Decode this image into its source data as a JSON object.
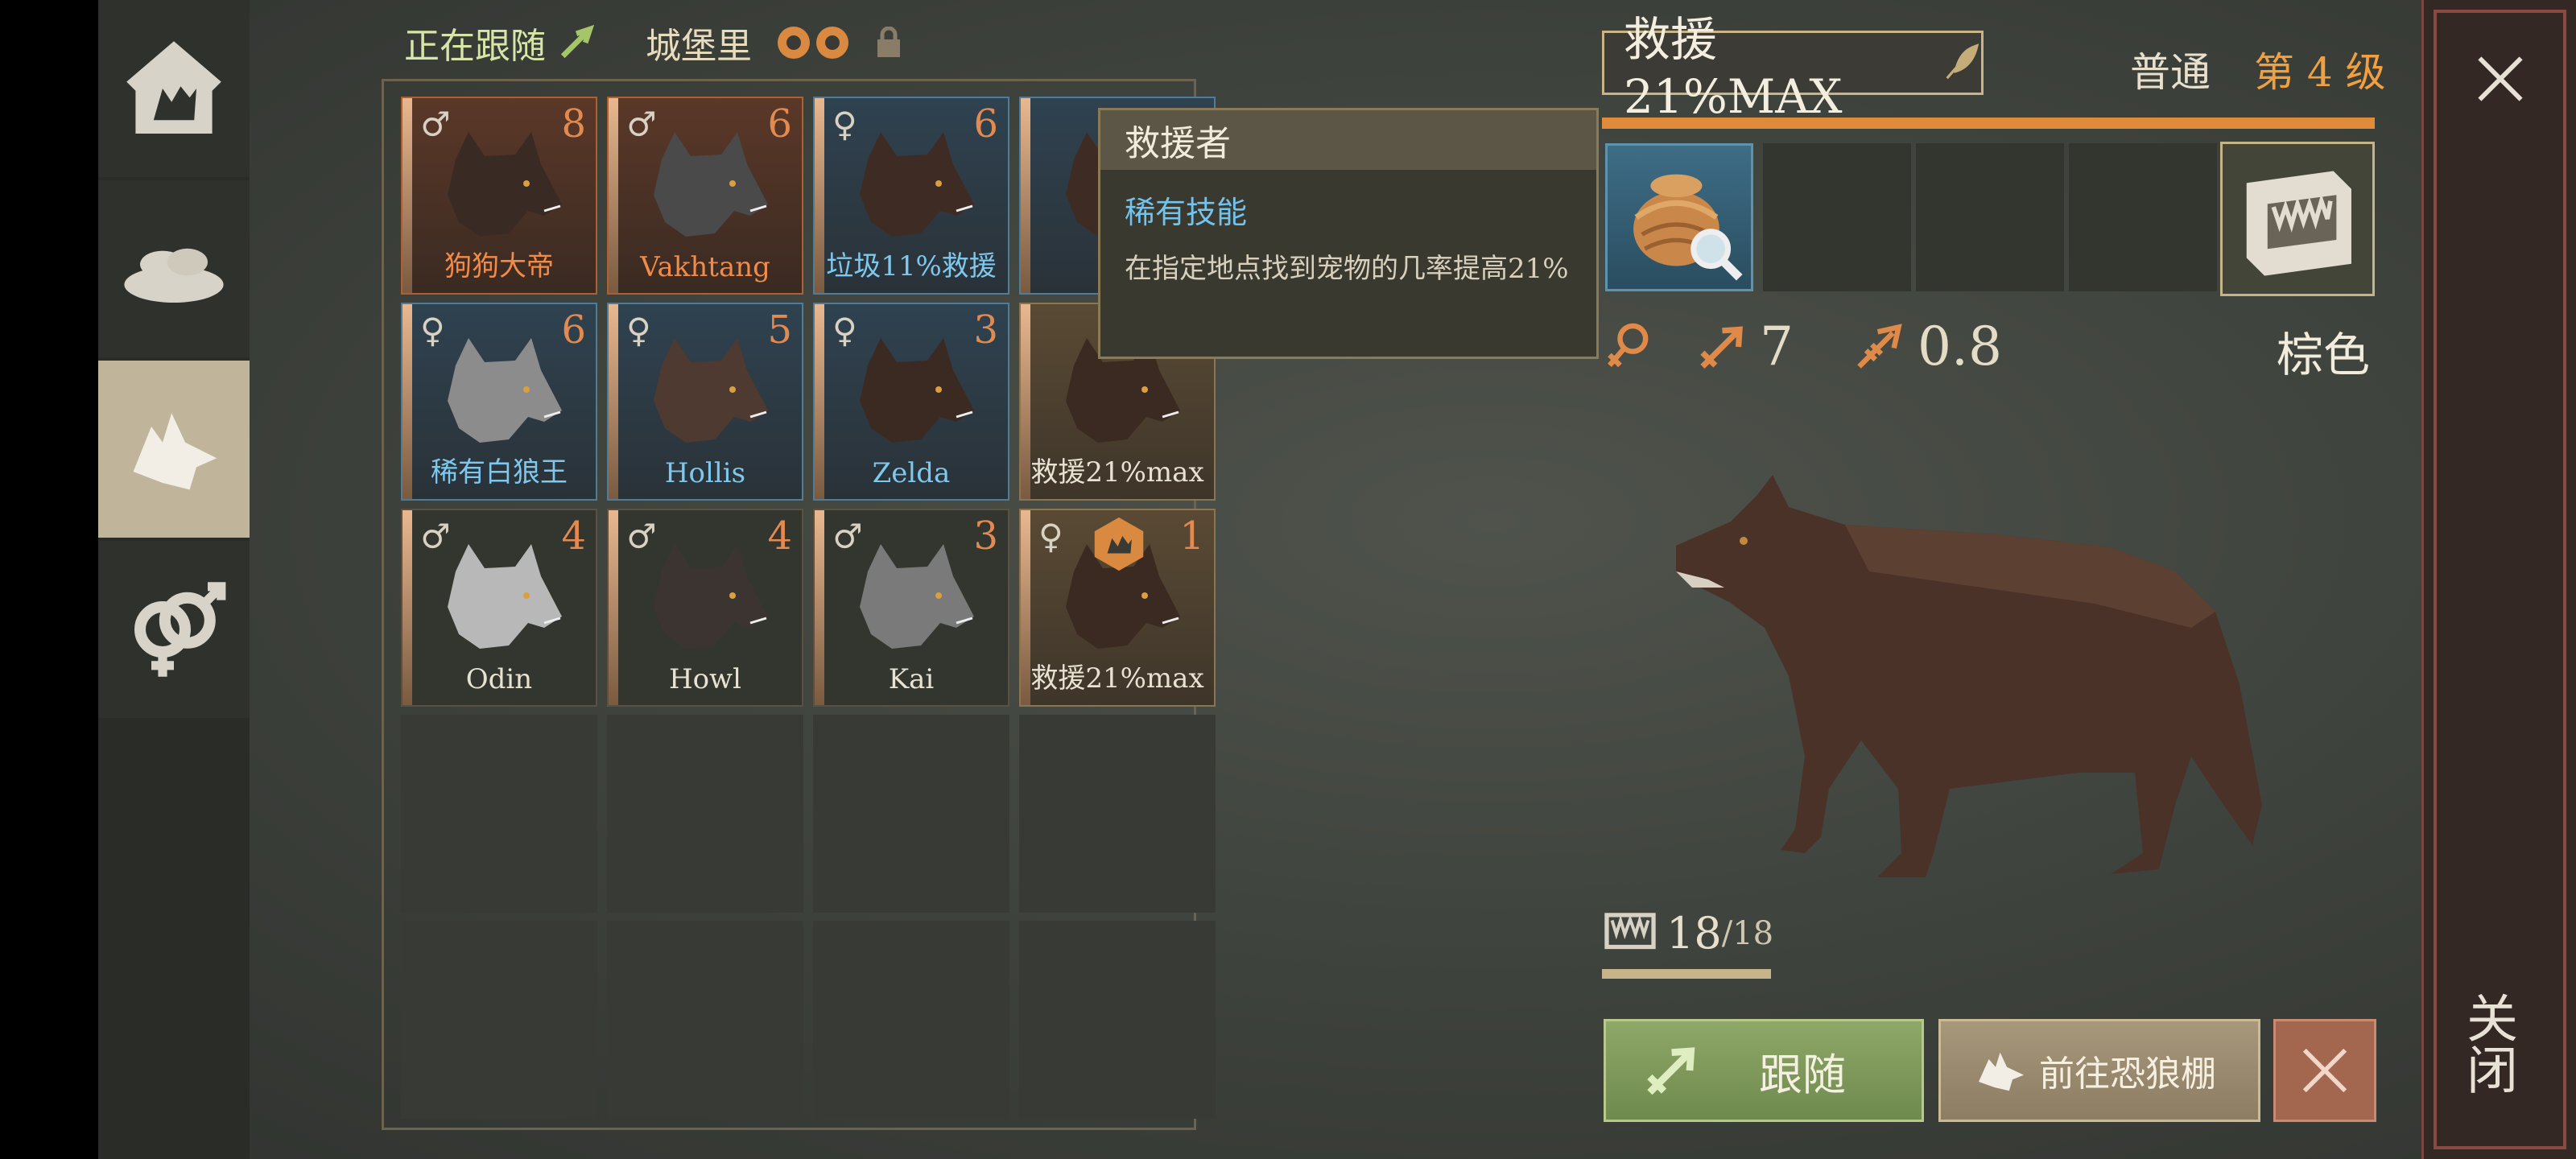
{
  "header": {
    "following_label": "正在跟随",
    "castle_label": "城堡里"
  },
  "pets": [
    {
      "gender": "♂",
      "level": "8",
      "name": "狗狗大帝",
      "rarity": "epic",
      "fur": "#3a2a24"
    },
    {
      "gender": "♂",
      "level": "6",
      "name": "Vakhtang",
      "rarity": "epic",
      "fur": "#4a4a4a"
    },
    {
      "gender": "♀",
      "level": "6",
      "name": "垃圾11%救援",
      "rarity": "rare",
      "fur": "#3e2c24"
    },
    {
      "gender": "",
      "level": "",
      "name": "",
      "rarity": "rare",
      "fur": "#3e2c24"
    },
    {
      "gender": "♀",
      "level": "6",
      "name": "稀有白狼王",
      "rarity": "rare",
      "fur": "#8c8c8c"
    },
    {
      "gender": "♀",
      "level": "5",
      "name": "Hollis",
      "rarity": "rare",
      "fur": "#4e3a30"
    },
    {
      "gender": "♀",
      "level": "3",
      "name": "Zelda",
      "rarity": "rare",
      "fur": "#3a2a22"
    },
    {
      "gender": "",
      "level": "",
      "name": "救援21%max",
      "rarity": "gold",
      "fur": "#3a2a22"
    },
    {
      "gender": "♂",
      "level": "4",
      "name": "Odin",
      "rarity": "norm",
      "fur": "#b8b8b8"
    },
    {
      "gender": "♂",
      "level": "4",
      "name": "Howl",
      "rarity": "norm",
      "fur": "#3c3430"
    },
    {
      "gender": "♂",
      "level": "3",
      "name": "Kai",
      "rarity": "norm",
      "fur": "#7a7a7a"
    },
    {
      "gender": "♀",
      "level": "1",
      "name": "救援21%max",
      "rarity": "gold",
      "fur": "#3a2a22"
    }
  ],
  "tooltip": {
    "title": "救援者",
    "type": "稀有技能",
    "description": "在指定地点找到宠物的几率提高21%"
  },
  "detail": {
    "name": "救援21%MAX",
    "rarity": "普通",
    "level": "第 4 级",
    "attack": "7",
    "speed": "0.8",
    "color_name": "棕色",
    "hunger_current": "18",
    "hunger_max": "/18",
    "hunger_fraction": 1.0
  },
  "buttons": {
    "follow": "跟随",
    "go_to_pen": "前往恐狼棚"
  },
  "close_label": "关闭",
  "colors": {
    "accent_orange": "#e08a3c",
    "rare_blue": "#7ec8ee",
    "follow_green": "#7f9a5a"
  }
}
